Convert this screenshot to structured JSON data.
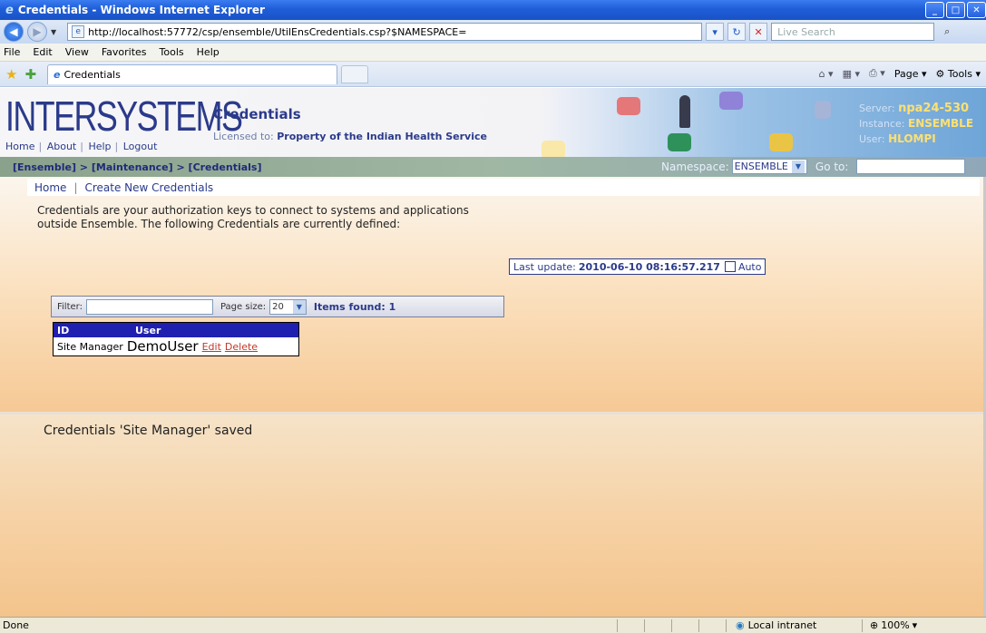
{
  "window": {
    "title": "Credentials - Windows Internet Explorer"
  },
  "address": {
    "url": "http://localhost:57772/csp/ensemble/UtilEnsCredentials.csp?$NAMESPACE=",
    "search_placeholder": "Live Search"
  },
  "menu": [
    "File",
    "Edit",
    "View",
    "Favorites",
    "Tools",
    "Help"
  ],
  "tab": {
    "label": "Credentials"
  },
  "toolbar_right": {
    "page": "Page",
    "tools": "Tools"
  },
  "banner": {
    "logo": "InterSystems",
    "links": [
      "Home",
      "About",
      "Help",
      "Logout"
    ],
    "title": "Credentials",
    "licensed_label": "Licensed to:",
    "licensed_value": "Property of the Indian Health Service",
    "server_label": "Server:",
    "server_value": "npa24-530",
    "instance_label": "Instance:",
    "instance_value": "ENSEMBLE",
    "user_label": "User:",
    "user_value": "HLOMPI"
  },
  "locator": {
    "crumbs": "[Ensemble] > [Maintenance] > [Credentials]",
    "namespace_label": "Namespace:",
    "namespace_value": "ENSEMBLE",
    "goto_label": "Go to:"
  },
  "subnav": {
    "home": "Home",
    "create": "Create New Credentials"
  },
  "description": "Credentials are your authorization keys to connect to systems and applications outside Ensemble. The following Credentials are currently defined:",
  "last_update": {
    "label": "Last update:",
    "value": "2010-06-10 08:16:57.217",
    "auto_label": "Auto"
  },
  "filter": {
    "label": "Filter:",
    "page_size_label": "Page size:",
    "page_size_value": "20",
    "items_found": "Items found: 1"
  },
  "table": {
    "headers": [
      "ID",
      "User"
    ],
    "rows": [
      {
        "id": "Site Manager",
        "user": "DemoUser",
        "edit": "Edit",
        "delete": "Delete"
      }
    ]
  },
  "message": "Credentials 'Site Manager' saved",
  "status": {
    "text": "Done",
    "zone": "Local intranet",
    "zoom": "100%"
  }
}
